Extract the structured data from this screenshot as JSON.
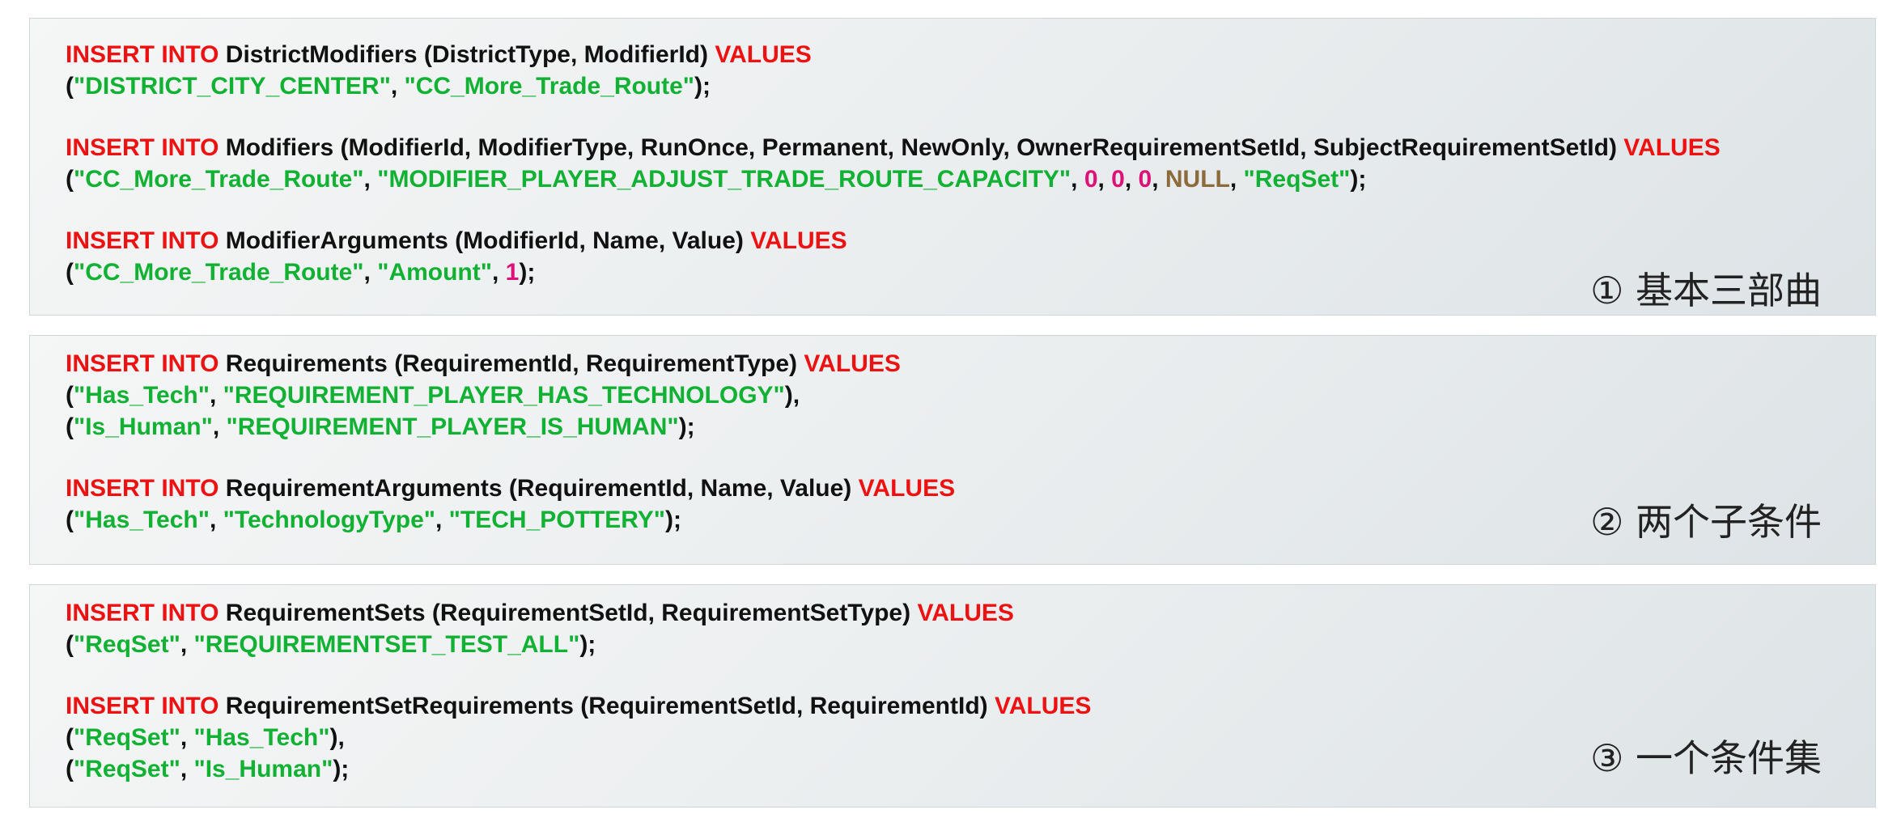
{
  "panels": [
    {
      "caption": "① 基本三部曲",
      "statements": [
        {
          "lines": [
            [
              {
                "t": "INSERT INTO",
                "c": "kw"
              },
              {
                "t": " DistrictModifiers (DistrictType, ModifierId) ",
                "c": "txt"
              },
              {
                "t": "VALUES",
                "c": "kw"
              }
            ],
            [
              {
                "t": "(",
                "c": "txt"
              },
              {
                "t": "\"DISTRICT_CITY_CENTER\"",
                "c": "str"
              },
              {
                "t": ", ",
                "c": "txt"
              },
              {
                "t": "\"CC_More_Trade_Route\"",
                "c": "str"
              },
              {
                "t": ");",
                "c": "txt"
              }
            ]
          ]
        },
        {
          "lines": [
            [
              {
                "t": "INSERT INTO",
                "c": "kw"
              },
              {
                "t": " Modifiers (ModifierId, ModifierType, RunOnce, Permanent, NewOnly, OwnerRequirementSetId, SubjectRequirementSetId) ",
                "c": "txt"
              },
              {
                "t": "VALUES",
                "c": "kw"
              }
            ],
            [
              {
                "t": "(",
                "c": "txt"
              },
              {
                "t": "\"CC_More_Trade_Route\"",
                "c": "str"
              },
              {
                "t": ", ",
                "c": "txt"
              },
              {
                "t": "\"MODIFIER_PLAYER_ADJUST_TRADE_ROUTE_CAPACITY\"",
                "c": "str"
              },
              {
                "t": ", ",
                "c": "txt"
              },
              {
                "t": "0",
                "c": "num"
              },
              {
                "t": ", ",
                "c": "txt"
              },
              {
                "t": "0",
                "c": "num"
              },
              {
                "t": ", ",
                "c": "txt"
              },
              {
                "t": "0",
                "c": "num"
              },
              {
                "t": ", ",
                "c": "txt"
              },
              {
                "t": "NULL",
                "c": "nul"
              },
              {
                "t": ", ",
                "c": "txt"
              },
              {
                "t": "\"ReqSet\"",
                "c": "str"
              },
              {
                "t": ");",
                "c": "txt"
              }
            ]
          ]
        },
        {
          "lines": [
            [
              {
                "t": "INSERT INTO",
                "c": "kw"
              },
              {
                "t": " ModifierArguments (ModifierId, Name, Value) ",
                "c": "txt"
              },
              {
                "t": "VALUES",
                "c": "kw"
              }
            ],
            [
              {
                "t": "(",
                "c": "txt"
              },
              {
                "t": "\"CC_More_Trade_Route\"",
                "c": "str"
              },
              {
                "t": ", ",
                "c": "txt"
              },
              {
                "t": "\"Amount\"",
                "c": "str"
              },
              {
                "t": ", ",
                "c": "txt"
              },
              {
                "t": "1",
                "c": "num"
              },
              {
                "t": ");",
                "c": "txt"
              }
            ]
          ]
        }
      ]
    },
    {
      "caption": "② 两个子条件",
      "statements": [
        {
          "lines": [
            [
              {
                "t": "INSERT INTO",
                "c": "kw"
              },
              {
                "t": " Requirements (RequirementId, RequirementType) ",
                "c": "txt"
              },
              {
                "t": "VALUES",
                "c": "kw"
              }
            ],
            [
              {
                "t": "(",
                "c": "txt"
              },
              {
                "t": "\"Has_Tech\"",
                "c": "str"
              },
              {
                "t": ", ",
                "c": "txt"
              },
              {
                "t": "\"REQUIREMENT_PLAYER_HAS_TECHNOLOGY\"",
                "c": "str"
              },
              {
                "t": "),",
                "c": "txt"
              }
            ],
            [
              {
                "t": "(",
                "c": "txt"
              },
              {
                "t": "\"Is_Human\"",
                "c": "str"
              },
              {
                "t": ", ",
                "c": "txt"
              },
              {
                "t": "\"REQUIREMENT_PLAYER_IS_HUMAN\"",
                "c": "str"
              },
              {
                "t": ");",
                "c": "txt"
              }
            ]
          ]
        },
        {
          "lines": [
            [
              {
                "t": "INSERT INTO",
                "c": "kw"
              },
              {
                "t": " RequirementArguments (RequirementId, Name, Value) ",
                "c": "txt"
              },
              {
                "t": "VALUES",
                "c": "kw"
              }
            ],
            [
              {
                "t": "(",
                "c": "txt"
              },
              {
                "t": "\"Has_Tech\"",
                "c": "str"
              },
              {
                "t": ", ",
                "c": "txt"
              },
              {
                "t": "\"TechnologyType\"",
                "c": "str"
              },
              {
                "t": ", ",
                "c": "txt"
              },
              {
                "t": "\"TECH_POTTERY\"",
                "c": "str"
              },
              {
                "t": ");",
                "c": "txt"
              }
            ]
          ]
        }
      ]
    },
    {
      "caption": "③ 一个条件集",
      "statements": [
        {
          "lines": [
            [
              {
                "t": "INSERT INTO",
                "c": "kw"
              },
              {
                "t": " RequirementSets (RequirementSetId, RequirementSetType) ",
                "c": "txt"
              },
              {
                "t": "VALUES",
                "c": "kw"
              }
            ],
            [
              {
                "t": "(",
                "c": "txt"
              },
              {
                "t": "\"ReqSet\"",
                "c": "str"
              },
              {
                "t": ", ",
                "c": "txt"
              },
              {
                "t": "\"REQUIREMENTSET_TEST_ALL\"",
                "c": "str"
              },
              {
                "t": ");",
                "c": "txt"
              }
            ]
          ]
        },
        {
          "lines": [
            [
              {
                "t": "INSERT INTO",
                "c": "kw"
              },
              {
                "t": " RequirementSetRequirements (RequirementSetId, RequirementId) ",
                "c": "txt"
              },
              {
                "t": "VALUES",
                "c": "kw"
              }
            ],
            [
              {
                "t": "(",
                "c": "txt"
              },
              {
                "t": "\"ReqSet\"",
                "c": "str"
              },
              {
                "t": ", ",
                "c": "txt"
              },
              {
                "t": "\"Has_Tech\"",
                "c": "str"
              },
              {
                "t": "),",
                "c": "txt"
              }
            ],
            [
              {
                "t": "(",
                "c": "txt"
              },
              {
                "t": "\"ReqSet\"",
                "c": "str"
              },
              {
                "t": ", ",
                "c": "txt"
              },
              {
                "t": "\"Is_Human\"",
                "c": "str"
              },
              {
                "t": ");",
                "c": "txt"
              }
            ]
          ]
        }
      ]
    }
  ]
}
